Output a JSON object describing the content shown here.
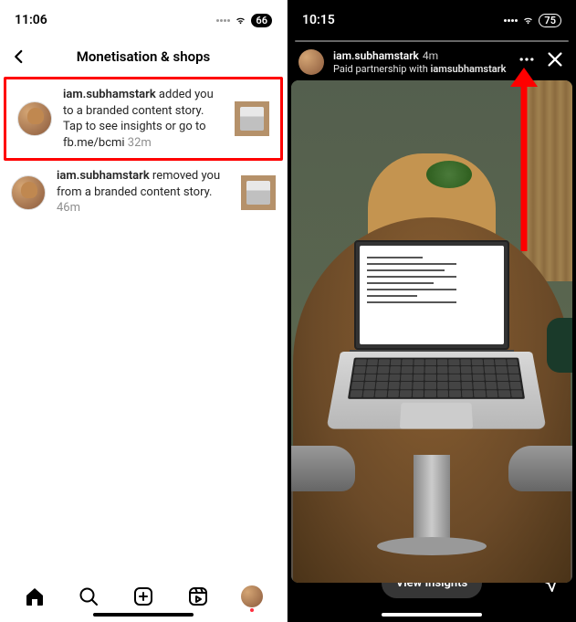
{
  "left": {
    "status": {
      "time": "11:06",
      "battery": "66"
    },
    "header": {
      "title": "Monetisation & shops"
    },
    "notifications": [
      {
        "username": "iam.subhamstark",
        "text": " added you to a branded content story. Tap to see insights or go to fb.me/bcmi ",
        "time": "32m"
      },
      {
        "username": "iam.subhamstark",
        "text": " removed you from a branded content story. ",
        "time": "46m"
      }
    ]
  },
  "right": {
    "status": {
      "time": "10:15",
      "battery": "75"
    },
    "story": {
      "username": "iam.subhamstark",
      "time": "4m",
      "subLabel": "Paid partnership with ",
      "partner": "iamsubhamstark"
    },
    "bottom": {
      "insightsLabel": "View Insights"
    }
  }
}
